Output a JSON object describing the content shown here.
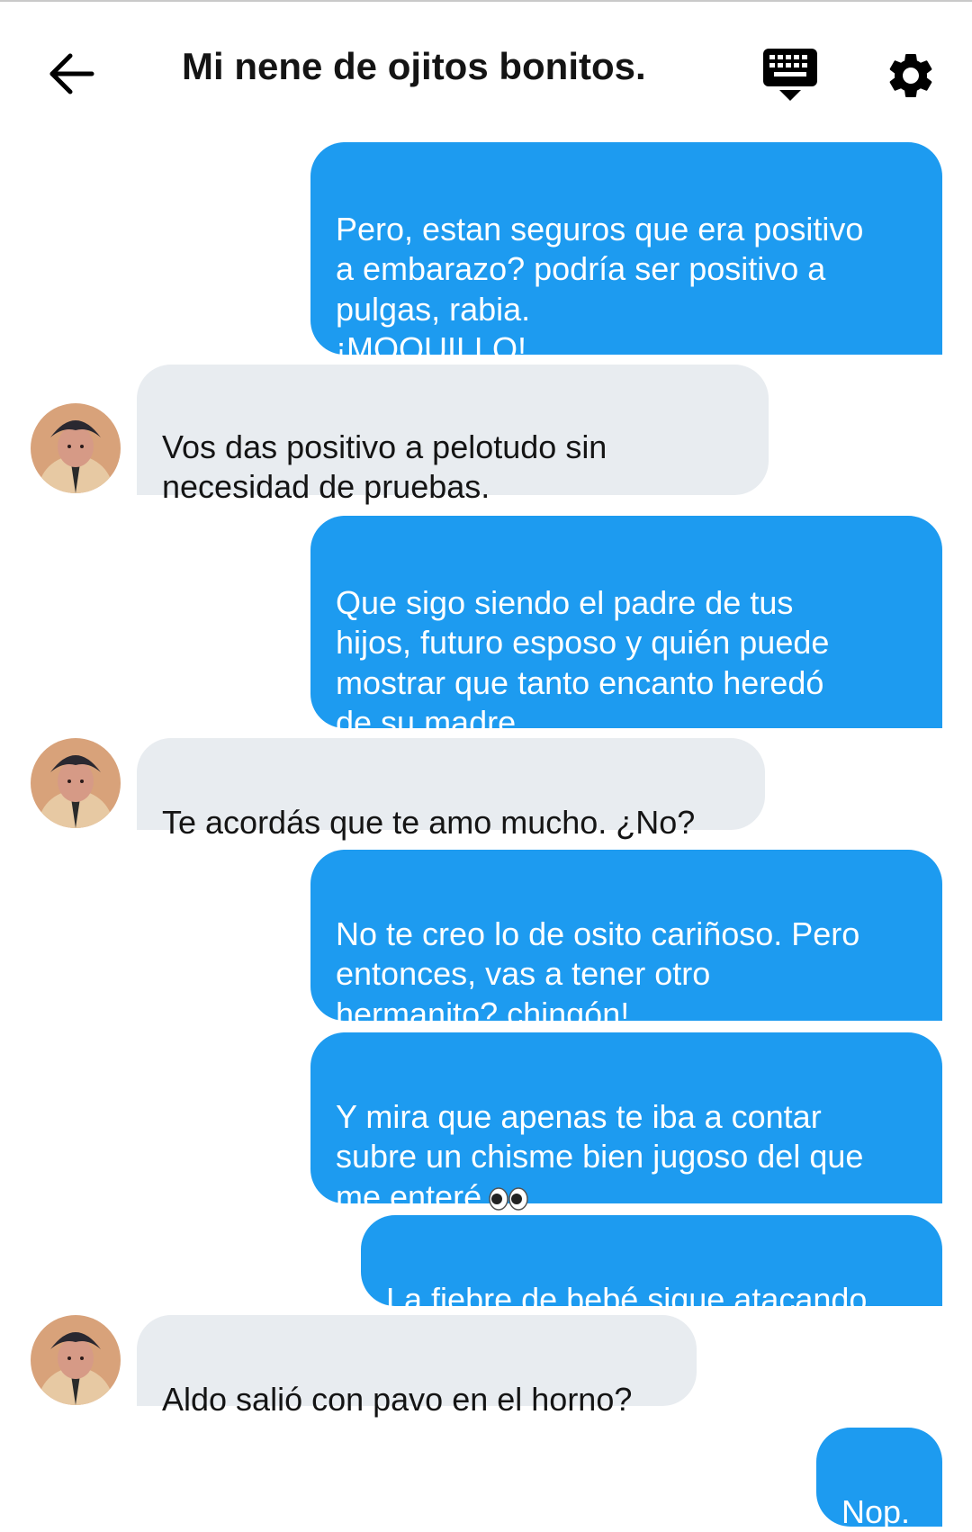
{
  "header": {
    "back_icon": "arrow-left-icon",
    "title": "Mi nene de ojitos bonitos.",
    "keyboard_icon": "keyboard-icon",
    "settings_icon": "gear-icon"
  },
  "colors": {
    "outgoing_bubble": "#1d9bf0",
    "incoming_bubble": "#e8ecf0",
    "text_dark": "#141414"
  },
  "messages": [
    {
      "direction": "outgoing",
      "text": "Pero, estan seguros que era positivo\na embarazo? podría ser positivo a\npulgas, rabia.\n¡MOQUILLO!"
    },
    {
      "direction": "incoming",
      "text": "Vos das positivo a pelotudo sin\nnecesidad de pruebas."
    },
    {
      "direction": "outgoing",
      "text": "Que sigo siendo el padre de tus\nhijos, futuro esposo y quién puede\nmostrar que tanto encanto heredó\nde su madre."
    },
    {
      "direction": "incoming",
      "text": "Te acordás que te amo mucho. ¿No?"
    },
    {
      "direction": "outgoing",
      "text": "No te creo lo de osito cariñoso. Pero\nentonces, vas a tener otro\nhermanito? chingón!"
    },
    {
      "direction": "outgoing",
      "text": "Y mira que apenas te iba a contar\nsubre un chisme bien jugoso del que\nme enteré",
      "emoji": "eyes-emoji"
    },
    {
      "direction": "outgoing",
      "text": "La fiebre de bebé sigue atacando."
    },
    {
      "direction": "incoming",
      "text": "Aldo salió con pavo en el horno?"
    },
    {
      "direction": "outgoing",
      "text": "Nop."
    }
  ]
}
